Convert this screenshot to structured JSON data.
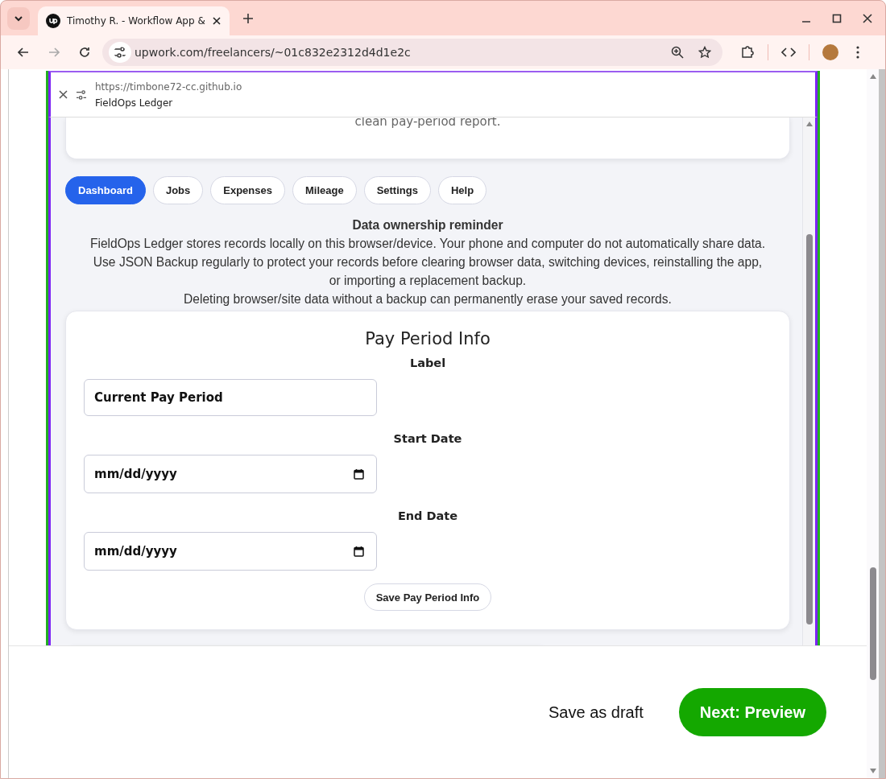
{
  "browser": {
    "tab_title": "Timothy R. - Workflow App &",
    "url": "upwork.com/freelancers/~01c832e2312d4d1e2c"
  },
  "preview_bar": {
    "url": "https://timbone72-cc.github.io",
    "title": "FieldOps Ledger"
  },
  "intro_card": {
    "text": "clean pay-period report."
  },
  "nav_tabs": [
    {
      "label": "Dashboard",
      "selected": true
    },
    {
      "label": "Jobs",
      "selected": false
    },
    {
      "label": "Expenses",
      "selected": false
    },
    {
      "label": "Mileage",
      "selected": false
    },
    {
      "label": "Settings",
      "selected": false
    },
    {
      "label": "Help",
      "selected": false
    }
  ],
  "reminder": {
    "title": "Data ownership reminder",
    "lines": [
      "FieldOps Ledger stores records locally on this browser/device. Your phone and computer do not automatically share data.",
      "Use JSON Backup regularly to protect your records before clearing browser data, switching devices, reinstalling the app,",
      "or importing a replacement backup.",
      "Deleting browser/site data without a backup can permanently erase your saved records."
    ]
  },
  "pay_period_card": {
    "title": "Pay Period Info",
    "fields": [
      {
        "label": "Label",
        "kind": "text",
        "value": "Current Pay Period"
      },
      {
        "label": "Start Date",
        "kind": "date",
        "placeholder": "mm/dd/yyyy"
      },
      {
        "label": "End Date",
        "kind": "date",
        "placeholder": "mm/dd/yyyy"
      }
    ],
    "button": "Save Pay Period Info"
  },
  "footer": {
    "buttons": [
      {
        "label": "Save as draft",
        "kind": "link"
      },
      {
        "label": "Next: Preview",
        "kind": "primary"
      }
    ]
  }
}
